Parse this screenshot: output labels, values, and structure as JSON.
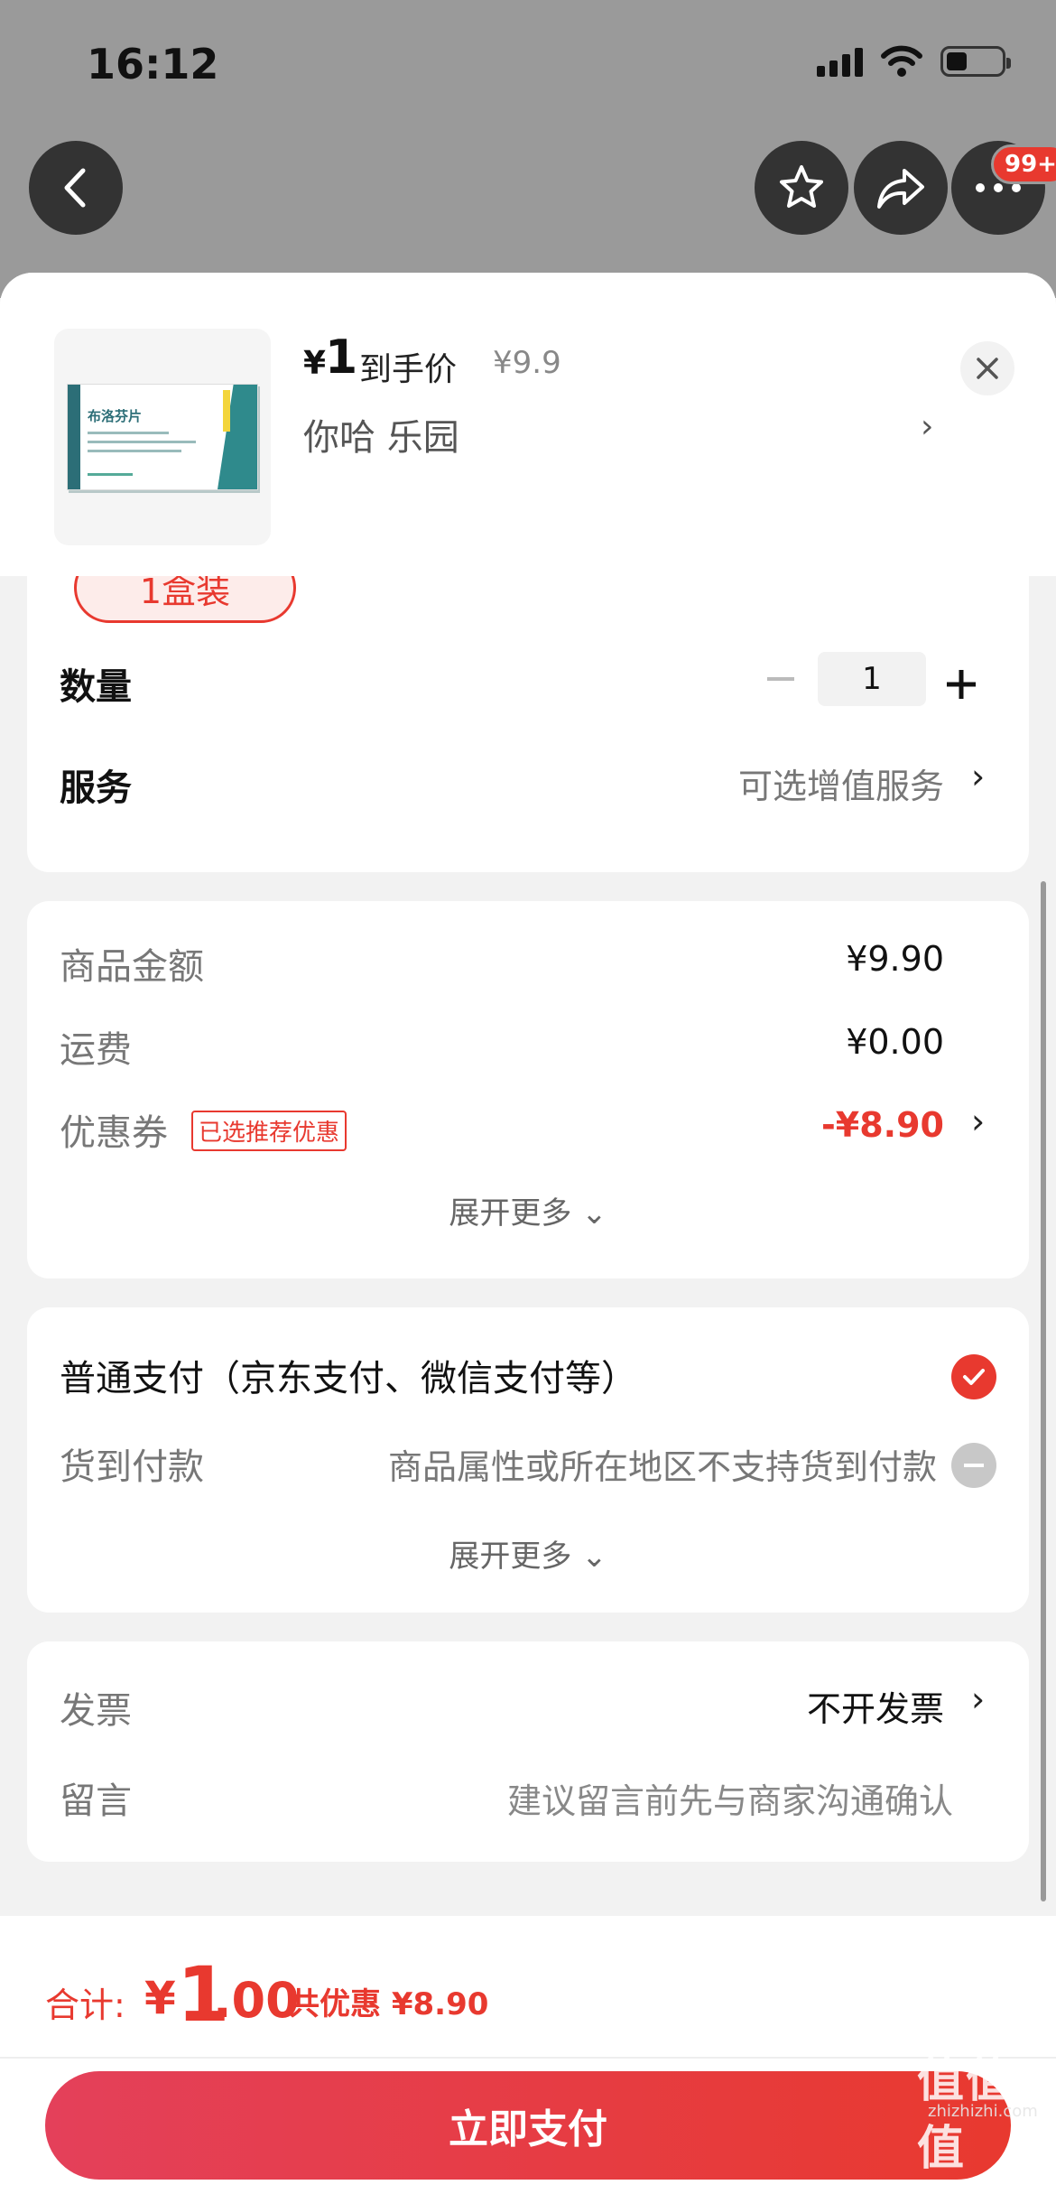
{
  "status_bar": {
    "time": "16:12"
  },
  "top_bar": {
    "badge": "99+"
  },
  "product": {
    "box_name": "布洛芬片",
    "price_yen": "¥",
    "price": "1",
    "price_label": "到手价",
    "original_price": "¥9.9",
    "spec_text": "你哈  乐园",
    "spec_chevron": "›"
  },
  "options": {
    "spec_chip": "1盒装",
    "quantity_label": "数量",
    "quantity_value": "1",
    "service_label": "服务",
    "service_value": "可选增值服务",
    "chevron": "›"
  },
  "amounts": {
    "goods_label": "商品金额",
    "goods_value": "¥9.90",
    "shipping_label": "运费",
    "shipping_value": "¥0.00",
    "coupon_label": "优惠券",
    "coupon_tag": "已选推荐优惠",
    "coupon_value": "-¥8.90",
    "expand": "展开更多 ⌄"
  },
  "payment": {
    "normal": "普通支付（京东支付、微信支付等）",
    "cod_label": "货到付款",
    "cod_note": "商品属性或所在地区不支持货到付款",
    "expand": "展开更多 ⌄"
  },
  "misc": {
    "invoice_label": "发票",
    "invoice_value": "不开发票",
    "message_label": "留言",
    "message_placeholder": "建议留言前先与商家沟通确认"
  },
  "footer": {
    "total_label": "合计:",
    "total_yen": "¥",
    "total_int": "1",
    "total_dec": ".00",
    "total_saving": "共优惠 ¥8.90",
    "pay_button": "立即支付"
  },
  "watermark": {
    "main": "值值值",
    "sub": "zhizhizhi.com"
  },
  "colors": {
    "accent": "#e8392f",
    "overlay": "#9a9a9a"
  }
}
